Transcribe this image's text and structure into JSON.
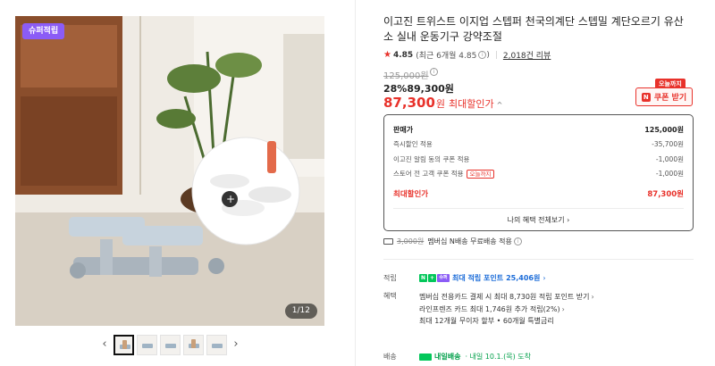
{
  "gallery": {
    "badge": "슈퍼적립",
    "counter": "1/12",
    "prev_arrow": "‹",
    "next_arrow": "›",
    "thumbnail_count": 5
  },
  "product": {
    "title": "이고진 트위스트 이지업 스텝퍼 천국의계단 스텝밀 계단오르기 유산소 실내 운동기구 강약조절",
    "rating": {
      "score": "4.85",
      "recent": "(최근 6개월 4.85",
      "recent_close": ")",
      "reviews": "2,018건 리뷰"
    },
    "price": {
      "original": "125,000원",
      "discount_rate": "28%",
      "sale_price": "89,300원",
      "best_price": "87,300",
      "best_unit": "원",
      "best_label": "최대할인가",
      "today_only": "오늘까지",
      "coupon_button": "쿠폰 받기"
    }
  },
  "benefit_box": {
    "rows": [
      {
        "label": "판매가",
        "value": "125,000원"
      },
      {
        "label": "즉시할인 적용",
        "value": "-35,700원"
      },
      {
        "label": "이고진 알림 동의 쿠폰 적용",
        "value": "-1,000원"
      },
      {
        "label": "스토어 전 고객 쿠폰 적용",
        "value": "-1,000원",
        "pill": "오늘까지"
      }
    ],
    "best_label": "최대할인가",
    "best_value": "87,300원",
    "link": "나의 혜택 전체보기"
  },
  "shipping": {
    "old_fee": "3,000원",
    "text": "멤버십 N배송 무료배송 적용"
  },
  "points": {
    "row_label": "적립",
    "label": "최대 적립 포인트",
    "amount": "25,406원",
    "icon_super": "슈퍼"
  },
  "benefits": {
    "row_label": "혜택",
    "lines": [
      "멤버십 전용카드 결제 시 최대 8,730원 적립 포인트 받기",
      "라인프렌즈 카드 최대 1,746원 추가 적립(2%)",
      "최대 12개월 무이자 할부 • 60개월 특별금리"
    ]
  },
  "delivery": {
    "row_label": "배송",
    "name": "내일배송",
    "date": "· 내일 10.1.(목) 도착"
  },
  "colors": {
    "accent_red": "#e8322b",
    "naver_green": "#03c75a",
    "point_blue": "#1a6bd8",
    "super_purple": "#8b5cf6"
  }
}
